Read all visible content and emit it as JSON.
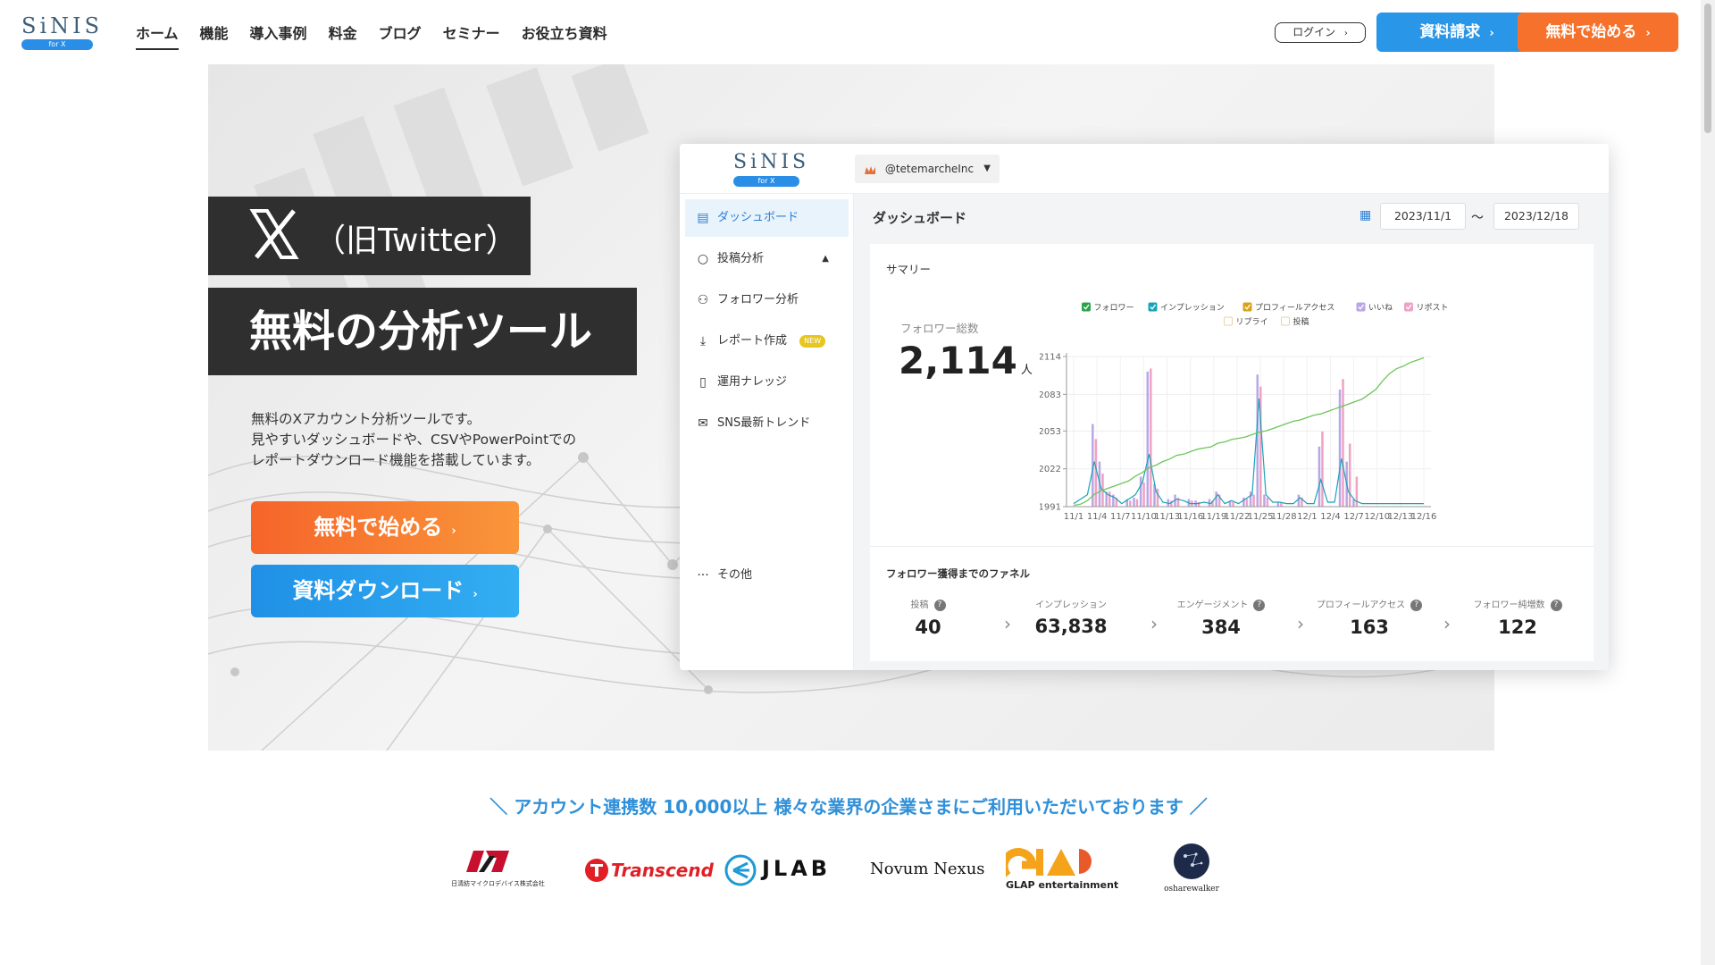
{
  "brand": {
    "name": "SiNIS",
    "sub": "for X"
  },
  "nav": [
    "ホーム",
    "機能",
    "導入事例",
    "料金",
    "ブログ",
    "セミナー",
    "お役立ち資料"
  ],
  "header_buttons": {
    "login": "ログイン",
    "docs": "資料請求",
    "free": "無料で始める"
  },
  "hero": {
    "x_sub": "（旧Twitter）",
    "title": "無料の分析ツール",
    "desc": [
      "無料のXアカウント分析ツールです。",
      "見やすいダッシュボードや、CSVやPowerPointでの",
      "レポートダウンロード機能を搭載しています。"
    ],
    "cta_free": "無料で始める",
    "cta_download": "資料ダウンロード"
  },
  "app": {
    "account": "@tetemarcheInc",
    "sidebar": [
      {
        "label": "ダッシュボード",
        "icon": "dashboard-icon"
      },
      {
        "label": "投稿分析",
        "icon": "chat-bubble-icon"
      },
      {
        "label": "フォロワー分析",
        "icon": "users-icon"
      },
      {
        "label": "レポート作成",
        "icon": "download-icon",
        "badge": "NEW"
      },
      {
        "label": "運用ナレッジ",
        "icon": "book-icon"
      },
      {
        "label": "SNS最新トレンド",
        "icon": "mail-icon"
      },
      {
        "label": "その他",
        "icon": "more-icon"
      }
    ],
    "page_title": "ダッシュボード",
    "date_from": "2023/11/1",
    "date_sep": "～",
    "date_to": "2023/12/18",
    "summary_title": "サマリー",
    "follower_label": "フォロワー総数",
    "follower_value": "2,114",
    "follower_unit": "人",
    "funnel_title": "フォロワー獲得までのファネル",
    "funnel": [
      {
        "label": "投稿",
        "value": "40"
      },
      {
        "label": "インプレッション",
        "value": "63,838"
      },
      {
        "label": "エンゲージメント",
        "value": "384"
      },
      {
        "label": "プロフィールアクセス",
        "value": "163"
      },
      {
        "label": "フォロワー純増数",
        "value": "122"
      }
    ]
  },
  "colors": {
    "accent_blue": "#2a96e8",
    "accent_orange": "#f6722c",
    "dark": "#2f2f2f"
  },
  "chart_data": {
    "type": "line",
    "legend": [
      {
        "name": "フォロワー",
        "checked": true,
        "color": "#2ca34a"
      },
      {
        "name": "インプレッション",
        "checked": true,
        "color": "#1aa3b8"
      },
      {
        "name": "プロフィールアクセス",
        "checked": true,
        "color": "#d8a21c"
      },
      {
        "name": "いいね",
        "checked": true,
        "color": "#b9a6e6"
      },
      {
        "name": "リポスト",
        "checked": true,
        "color": "#eea2c4"
      },
      {
        "name": "リプライ",
        "checked": false,
        "color": "#e7d3a6"
      },
      {
        "name": "投稿",
        "checked": false,
        "color": "#e7d3a6"
      }
    ],
    "x_ticks": [
      "11/1",
      "11/4",
      "11/7",
      "11/10",
      "11/13",
      "11/16",
      "11/19",
      "11/22",
      "11/25",
      "11/28",
      "12/1",
      "12/4",
      "12/7",
      "12/10",
      "12/13",
      "12/16"
    ],
    "y_ticks": [
      1991,
      2022,
      2053,
      2083,
      2114
    ],
    "ylim": [
      1991,
      2114
    ],
    "followers": [
      1992,
      1993,
      1996,
      2001,
      2004,
      2006,
      2008,
      2010,
      2012,
      2016,
      2019,
      2023,
      2025,
      2028,
      2030,
      2033,
      2034,
      2036,
      2038,
      2039,
      2040,
      2043,
      2044,
      2046,
      2047,
      2048,
      2050,
      2052,
      2053,
      2055,
      2057,
      2059,
      2061,
      2062,
      2064,
      2066,
      2067,
      2069,
      2071,
      2073,
      2075,
      2077,
      2079,
      2083,
      2087,
      2094,
      2100,
      2104,
      2106,
      2109,
      2111,
      2113
    ],
    "impressions": [
      0.02,
      0.05,
      0.08,
      0.3,
      0.12,
      0.08,
      0.06,
      0.02,
      0.05,
      0.08,
      0.16,
      0.35,
      0.1,
      0.03,
      0.02,
      0.05,
      0.04,
      0.02,
      0.02,
      0.03,
      0.02,
      0.08,
      0.02,
      0.04,
      0.02,
      0.05,
      0.08,
      0.72,
      0.08,
      0.03,
      0.03,
      0.02,
      0.02,
      0.06,
      0.02,
      0.02,
      0.18,
      0.03,
      0.03,
      0.32,
      0.1,
      0.04,
      0.02,
      0.02,
      0.02,
      0.02,
      0.02,
      0.02,
      0.02,
      0.02,
      0.02,
      0.02
    ],
    "likes": [
      0,
      0,
      0,
      0.55,
      0.3,
      0.1,
      0.08,
      0,
      0.05,
      0.06,
      0.2,
      0.9,
      0.15,
      0,
      0.05,
      0.08,
      0,
      0.05,
      0.04,
      0,
      0.05,
      0.1,
      0,
      0.04,
      0,
      0.06,
      0.1,
      0.88,
      0.08,
      0,
      0.03,
      0,
      0,
      0.08,
      0,
      0,
      0.4,
      0,
      0,
      0.78,
      0.3,
      0.05,
      0,
      0,
      0,
      0,
      0,
      0,
      0,
      0,
      0,
      0
    ],
    "reposts": [
      0,
      0,
      0,
      0.45,
      0.22,
      0.1,
      0.06,
      0,
      0.04,
      0.05,
      0.16,
      0.92,
      0.12,
      0,
      0.04,
      0.06,
      0,
      0.04,
      0.03,
      0,
      0.04,
      0.08,
      0,
      0.03,
      0,
      0.05,
      0.08,
      0.8,
      0.06,
      0,
      0.03,
      0,
      0,
      0.06,
      0,
      0,
      0.5,
      0,
      0,
      0.85,
      0.42,
      0.2,
      0,
      0,
      0,
      0,
      0,
      0,
      0,
      0,
      0,
      0
    ]
  },
  "clients": {
    "heading": "＼ アカウント連携数 10,000以上 様々な業界の企業さまにご利用いただいております ／",
    "logos": [
      "日清紡マイクロデバイス株式会社",
      "Transcend",
      "JLAB",
      "Novum Nexus",
      "GLAP entertainment",
      "osharewalker"
    ]
  }
}
